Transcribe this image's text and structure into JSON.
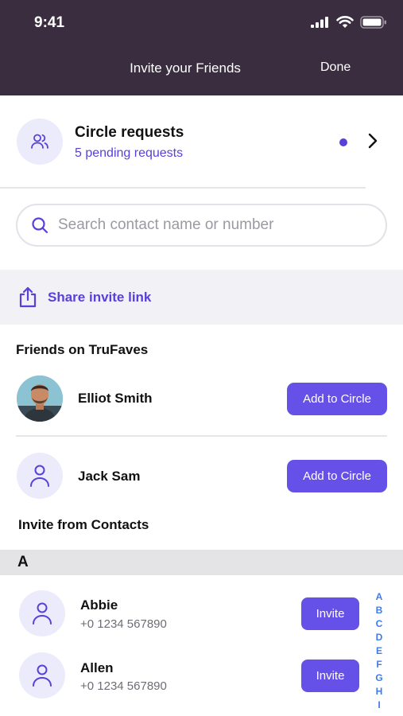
{
  "status_bar": {
    "time": "9:41"
  },
  "nav": {
    "title": "Invite your Friends",
    "done_label": "Done"
  },
  "circle_requests": {
    "title": "Circle requests",
    "subtitle": "5 pending requests"
  },
  "search": {
    "placeholder": "Search contact name or number",
    "value": ""
  },
  "share": {
    "label": "Share invite link"
  },
  "friends_section": {
    "title": "Friends on TruFaves",
    "items": [
      {
        "name": "Elliot Smith",
        "button": "Add to Circle"
      },
      {
        "name": "Jack Sam",
        "button": "Add to Circle"
      }
    ]
  },
  "contacts_section": {
    "title": "Invite from Contacts",
    "letter": "A",
    "items": [
      {
        "name": "Abbie",
        "number": "+0 1234 567890",
        "button": "Invite"
      },
      {
        "name": "Allen",
        "number": "+0 1234 567890",
        "button": "Invite"
      }
    ]
  },
  "alpha_index": [
    "A",
    "B",
    "C",
    "D",
    "E",
    "F",
    "G",
    "H",
    "I"
  ],
  "colors": {
    "header_bg": "#3a2d3f",
    "accent": "#6551e8",
    "index_blue": "#3d7cf0"
  }
}
